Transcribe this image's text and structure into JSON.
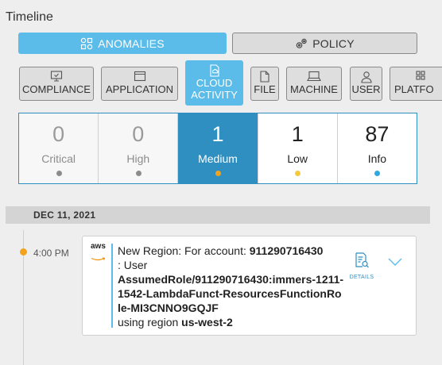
{
  "header": {
    "title": "Timeline"
  },
  "view_toggle": {
    "anomalies_label": "ANOMALIES",
    "policy_label": "POLICY",
    "selected": "anomalies"
  },
  "categories": [
    {
      "label": "COMPLIANCE",
      "icon": "monitor-check-icon"
    },
    {
      "label": "APPLICATION",
      "icon": "window-icon"
    },
    {
      "label": "CLOUD\nACTIVITY",
      "icon": "cloud-doc-icon",
      "selected": true
    },
    {
      "label": "FILE",
      "icon": "file-icon"
    },
    {
      "label": "MACHINE",
      "icon": "laptop-icon"
    },
    {
      "label": "USER",
      "icon": "user-icon"
    },
    {
      "label": "PLATFO",
      "icon": "grid-icon"
    }
  ],
  "severity": [
    {
      "count": "0",
      "label": "Critical",
      "dot_color": "#8c8c8c"
    },
    {
      "count": "0",
      "label": "High",
      "dot_color": "#8c8c8c"
    },
    {
      "count": "1",
      "label": "Medium",
      "dot_color": "#f2a21c",
      "selected": true
    },
    {
      "count": "1",
      "label": "Low",
      "dot_color": "#f5c842"
    },
    {
      "count": "87",
      "label": "Info",
      "dot_color": "#2fa8e0"
    }
  ],
  "timeline": {
    "date": "DEC 11, 2021",
    "events": [
      {
        "time": "4:00 PM",
        "source_logo": "aws",
        "text_prefix": "New Region: For account: ",
        "account": "911290716430",
        "text_mid": ": User",
        "role": "AssumedRole/911290716430:immers-1211-1542-LambdaFunct-ResourcesFunctionRole-MI3CNNO9GQJF",
        "text_region_prefix": "using region ",
        "region": "us-west-2",
        "details_label": "DETAILS",
        "dot_color": "#f2a21c"
      }
    ]
  },
  "colors": {
    "accent": "#5bbce9",
    "selected_severity": "#2f8fc0"
  }
}
